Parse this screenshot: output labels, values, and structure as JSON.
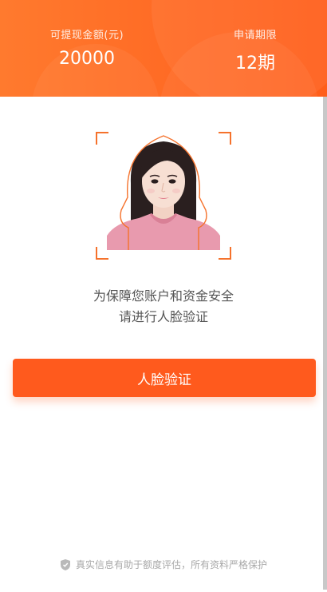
{
  "header": {
    "withdrawable_label": "可提现金额(元)",
    "withdrawable_value": "20000",
    "period_label": "申请期限",
    "period_value": "12期"
  },
  "verify": {
    "line1": "为保障您账户和资金安全",
    "line2": "请进行人脸验证",
    "button_label": "人脸验证"
  },
  "footer": {
    "icon": "shield-icon",
    "text": "真实信息有助于额度评估，所有资料严格保护"
  },
  "colors": {
    "brand": "#ff5a1d",
    "frame": "#f5722c"
  }
}
